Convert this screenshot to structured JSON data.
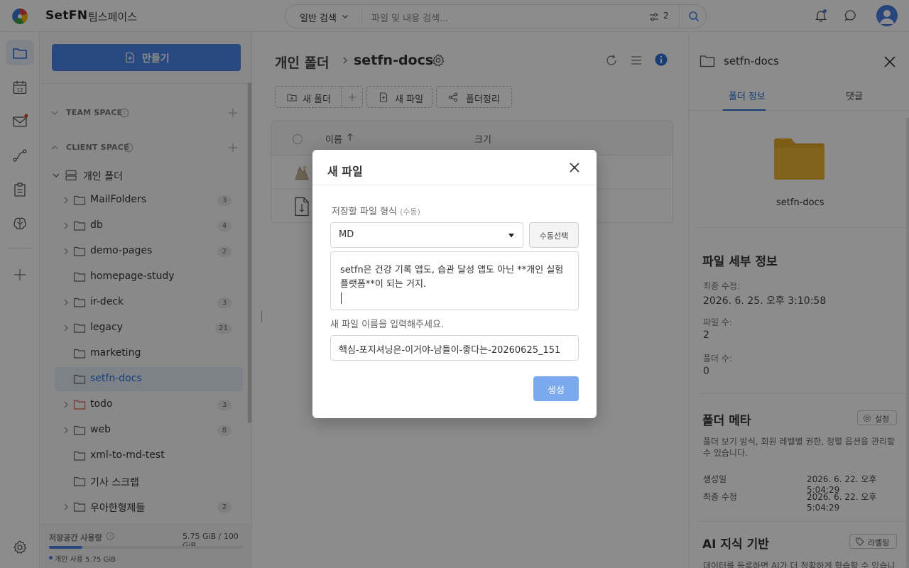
{
  "topbar": {
    "brand": "SetFN",
    "workspace": "팀스페이스",
    "search_mode": "일반 검색",
    "search_placeholder": "파일 및 내용 검색...",
    "filter_count": "2"
  },
  "sidebar": {
    "create_label": "만들기",
    "team_space": "TEAM SPACE",
    "client_space": "CLIENT SPACE",
    "root_folder": "개인 폴더",
    "items": [
      {
        "label": "MailFolders",
        "count": "3"
      },
      {
        "label": "db",
        "count": "4"
      },
      {
        "label": "demo-pages",
        "count": "2"
      },
      {
        "label": "homepage-study",
        "count": ""
      },
      {
        "label": "ir-deck",
        "count": "3"
      },
      {
        "label": "legacy",
        "count": "21"
      },
      {
        "label": "marketing",
        "count": ""
      },
      {
        "label": "setfn-docs",
        "count": ""
      },
      {
        "label": "todo",
        "count": "3"
      },
      {
        "label": "web",
        "count": "8"
      },
      {
        "label": "xml-to-md-test",
        "count": ""
      },
      {
        "label": "기사 스크랩",
        "count": ""
      },
      {
        "label": "우아한형제들",
        "count": "2"
      }
    ],
    "storage": {
      "label": "저장공간 사용량",
      "value": "5.75 GiB / 100 GiB",
      "used_fraction": 0.0575,
      "personal": "개인 사용 5.75 GiB"
    }
  },
  "main": {
    "breadcrumb_root": "개인 폴더",
    "breadcrumb_current": "setfn-docs",
    "toolbar": {
      "new_folder": "새 폴더",
      "new_file": "새 파일",
      "organize": "폴더정리"
    },
    "table": {
      "col_name": "이름",
      "col_size": "크기"
    }
  },
  "panel": {
    "title": "setfn-docs",
    "tab_info": "폴더 정보",
    "tab_comments": "댓글",
    "folder_name": "setfn-docs",
    "detail_title": "파일 세부 정보",
    "last_modified_label": "최종 수정:",
    "last_modified": "2026. 6. 25. 오후 3:10:58",
    "file_count_label": "파일 수:",
    "file_count": "2",
    "folder_count_label": "폴더 수:",
    "folder_count": "0",
    "meta_title": "폴더 메타",
    "settings_label": "설정",
    "meta_desc": "폴더 보기 방식, 회원 레벨별 권한, 정렬 옵션을 관리할 수 있습니다.",
    "created_label": "생성일",
    "created": "2026. 6. 22. 오후 5:04:29",
    "modified_label": "최종 수정",
    "modified": "2026. 6. 22. 오후 5:04:29",
    "ai_title": "AI 지식 기반",
    "labeling_label": "라벨링",
    "ai_desc": "데이터를 등록하면 AI가 더 정확하게 학습할 수 있습니"
  },
  "modal": {
    "title": "새 파일",
    "format_label": "저장할 파일 형식",
    "format_hint": "(수동)",
    "format_value": "MD",
    "manual_button": "수동선택",
    "content": "setfn은 건강 기록 앱도, 습관 달성 앱도 아닌 **개인 실험 플랫폼**이 되는 거지.",
    "name_label": "새 파일 이름을 입력해주세요.",
    "name_value": "핵심-포지셔닝은-이거야-남들이-좋다는-20260625_151",
    "create_button": "생성"
  },
  "colors": {
    "primary": "#4a86e8",
    "folder_yellow": "#e3a82b",
    "active_text": "#2b6fd6"
  }
}
